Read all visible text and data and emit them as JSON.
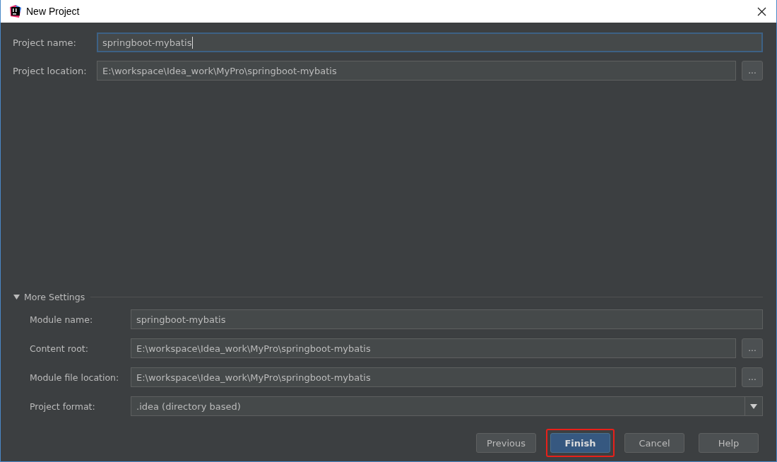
{
  "window": {
    "title": "New Project"
  },
  "fields": [
    {
      "label": "Project name:",
      "value": "springboot-mybatis",
      "kind": "text",
      "focused": true
    },
    {
      "label": "Project location:",
      "value": "E:\\workspace\\Idea_work\\MyPro\\springboot-mybatis",
      "kind": "path",
      "browse": "...",
      "focused": false
    }
  ],
  "more_settings": {
    "label": "More Settings",
    "expanded": true,
    "fields": [
      {
        "label": "Module name:",
        "value": "springboot-mybatis",
        "kind": "text",
        "focused": false
      },
      {
        "label": "Content root:",
        "value": "E:\\workspace\\Idea_work\\MyPro\\springboot-mybatis",
        "kind": "path",
        "browse": "...",
        "focused": false
      },
      {
        "label": "Module file location:",
        "value": "E:\\workspace\\Idea_work\\MyPro\\springboot-mybatis",
        "kind": "path",
        "browse": "...",
        "focused": false
      },
      {
        "label": "Project format:",
        "value": ".idea (directory based)",
        "kind": "select",
        "focused": false
      }
    ]
  },
  "buttons": [
    {
      "label": "Previous",
      "default": false,
      "highlighted": false
    },
    {
      "label": "Finish",
      "default": true,
      "highlighted": true
    },
    {
      "label": "Cancel",
      "default": false,
      "highlighted": false
    },
    {
      "label": "Help",
      "default": false,
      "highlighted": false
    }
  ]
}
